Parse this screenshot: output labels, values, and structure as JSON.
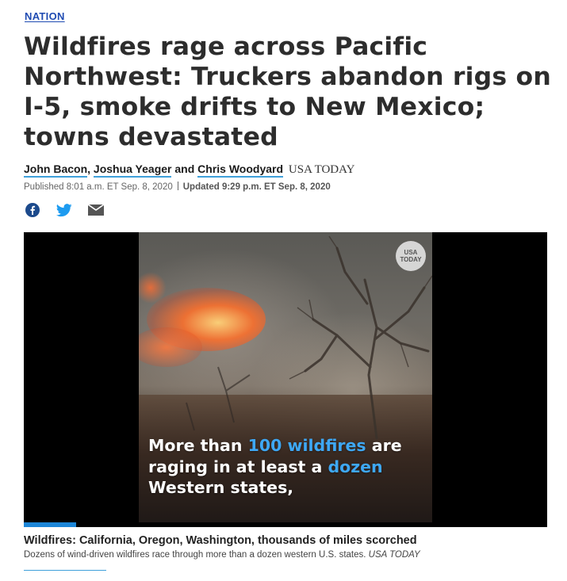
{
  "section": {
    "label": "NATION"
  },
  "headline": "Wildfires rage across Pacific Northwest: Truckers abandon rigs on I-5, smoke drifts to New Mexico; towns devastated",
  "byline": {
    "authors": [
      "John Bacon",
      "Joshua Yeager",
      "Chris Woodyard"
    ],
    "sep_comma": ",",
    "sep_and": "and",
    "outlet": "USA TODAY"
  },
  "timestamps": {
    "published": "Published 8:01 a.m. ET Sep. 8, 2020",
    "updated": "Updated 9:29 p.m. ET Sep. 8, 2020"
  },
  "share": {
    "icons": [
      "facebook-icon",
      "twitter-icon",
      "email-icon"
    ]
  },
  "video": {
    "badge_line1": "USA",
    "badge_line2": "TODAY",
    "overlay": {
      "t1": "More than ",
      "t2": "100 wildfires",
      "t3": " are raging in at least a ",
      "t4": "dozen",
      "t5": " Western states,"
    },
    "progress_fraction": 0.1,
    "title": "Wildfires: California, Oregon, Washington, thousands of miles scorched",
    "description": "Dozens of wind-driven wildfires race through more than a dozen western U.S. states.",
    "credit": "USA TODAY"
  },
  "colors": {
    "section_link": "#1f4bb2",
    "accent_blue": "#3fa0da",
    "overlay_highlight": "#3ea8f5",
    "progress_fill": "#1c86d8"
  }
}
